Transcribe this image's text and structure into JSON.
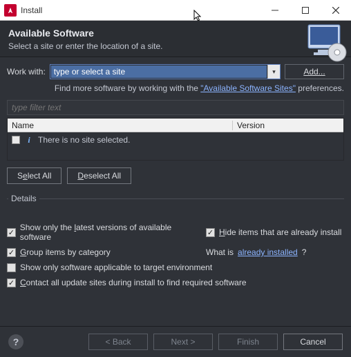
{
  "window": {
    "title": "Install",
    "icon": "angular-icon"
  },
  "header": {
    "title": "Available Software",
    "subtitle": "Select a site or enter the location of a site."
  },
  "workwith": {
    "label": "Work with:",
    "placeholder": "type or select a site",
    "value": "type or select a site",
    "add_label": "Add..."
  },
  "hint": {
    "prefix": "Find more software by working with the ",
    "link": "\"Available Software Sites\"",
    "suffix": " preferences."
  },
  "filter": {
    "placeholder": "type filter text"
  },
  "table": {
    "columns": {
      "name": "Name",
      "version": "Version"
    },
    "empty_text": "There is no site selected."
  },
  "buttons": {
    "select_all_pre": "S",
    "select_all_ul": "e",
    "select_all_post": "lect All",
    "deselect_all_ul": "D",
    "deselect_all_post": "eselect All"
  },
  "details": {
    "legend": "Details"
  },
  "options": {
    "latest_pre": "Show only the ",
    "latest_ul": "l",
    "latest_post": "atest versions of available software",
    "latest_checked": true,
    "hide_ul": "H",
    "hide_post": "ide items that are already install",
    "hide_checked": true,
    "group_ul": "G",
    "group_post": "roup items by category",
    "group_checked": true,
    "already_prefix": "What is ",
    "already_link": "already installed",
    "already_suffix": "?",
    "target_env": "Show only software applicable to target environment",
    "target_env_checked": false,
    "contact_ul": "C",
    "contact_post": "ontact all update sites during install to find required software",
    "contact_checked": true
  },
  "footer": {
    "back": "< Back",
    "next": "Next >",
    "finish": "Finish",
    "cancel": "Cancel"
  }
}
